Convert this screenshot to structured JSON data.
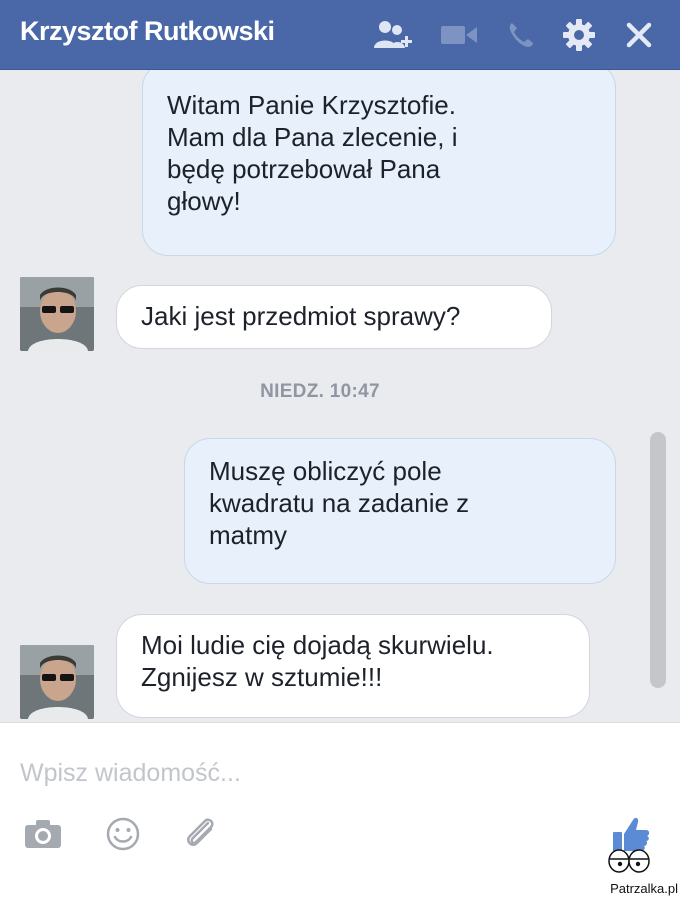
{
  "header": {
    "title": "Krzysztof Rutkowski",
    "icons": [
      "add-friend-icon",
      "video-call-icon",
      "phone-icon",
      "gear-icon",
      "close-icon"
    ],
    "background": "#4a67a8"
  },
  "messages": [
    {
      "direction": "outgoing",
      "lines": [
        "Witam Panie Krzysztofie.",
        "Mam dla Pana zlecenie, i",
        "będę potrzebował Pana",
        "głowy!"
      ]
    },
    {
      "direction": "incoming",
      "lines": [
        "Jaki jest przedmiot sprawy?"
      ]
    },
    {
      "direction": "outgoing",
      "lines": [
        "Muszę obliczyć pole",
        "kwadratu na zadanie z",
        "matmy"
      ]
    },
    {
      "direction": "incoming",
      "lines": [
        "Moi ludie cię dojadą skurwielu.",
        "Zgnijesz w sztumie!!!"
      ]
    }
  ],
  "timestamp": "NIEDZ. 10:47",
  "composer": {
    "placeholder": "Wpisz wiadomość...",
    "tools": [
      "camera-icon",
      "emoji-icon",
      "paperclip-icon",
      "like-icon"
    ]
  },
  "watermark": "Patrzalka.pl",
  "colors": {
    "outgoing_bubble": "#e7f0fb",
    "incoming_bubble": "#ffffff",
    "chat_background": "#e9ebee"
  }
}
